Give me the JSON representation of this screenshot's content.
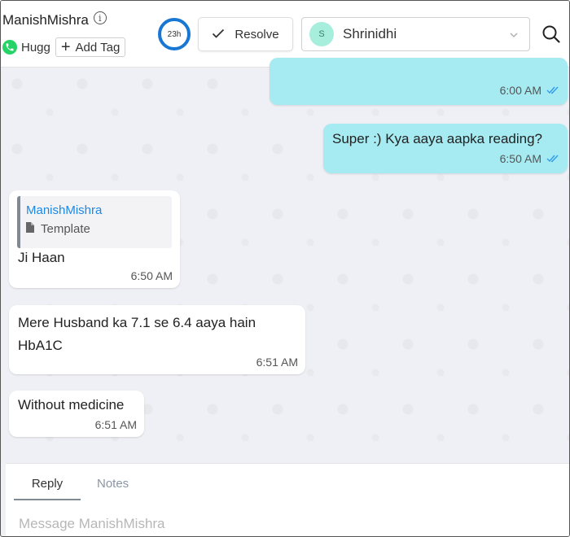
{
  "header": {
    "contact_name": "ManishMishra",
    "channel_label": "Hugg",
    "add_tag_label": "Add Tag",
    "sla_timer": "23h",
    "resolve_label": "Resolve",
    "assignee": {
      "initial": "S",
      "name": "Shrinidhi"
    }
  },
  "messages": [
    {
      "direction": "outgoing",
      "text": "",
      "time": "6:00 AM",
      "status": "read"
    },
    {
      "direction": "outgoing",
      "text": "Super :) Kya aaya aapka reading?",
      "time": "6:50 AM",
      "status": "read"
    },
    {
      "direction": "incoming",
      "quote": {
        "author": "ManishMishra",
        "type": "Template"
      },
      "text": "Ji Haan",
      "time": "6:50 AM"
    },
    {
      "direction": "incoming",
      "text": "Mere Husband ka 7.1 se 6.4 aaya hain HbA1C",
      "time": "6:51 AM"
    },
    {
      "direction": "incoming",
      "text": "Without medicine",
      "time": "6:51 AM"
    }
  ],
  "composer": {
    "tabs": [
      {
        "label": "Reply",
        "active": true
      },
      {
        "label": "Notes",
        "active": false
      }
    ],
    "placeholder": "Message ManishMishra"
  },
  "colors": {
    "outgoing_bubble": "#a7ebf2",
    "incoming_bubble": "#ffffff",
    "accent_blue": "#1877d2",
    "read_ticks": "#2f9de8",
    "whatsapp_green": "#25d366"
  }
}
